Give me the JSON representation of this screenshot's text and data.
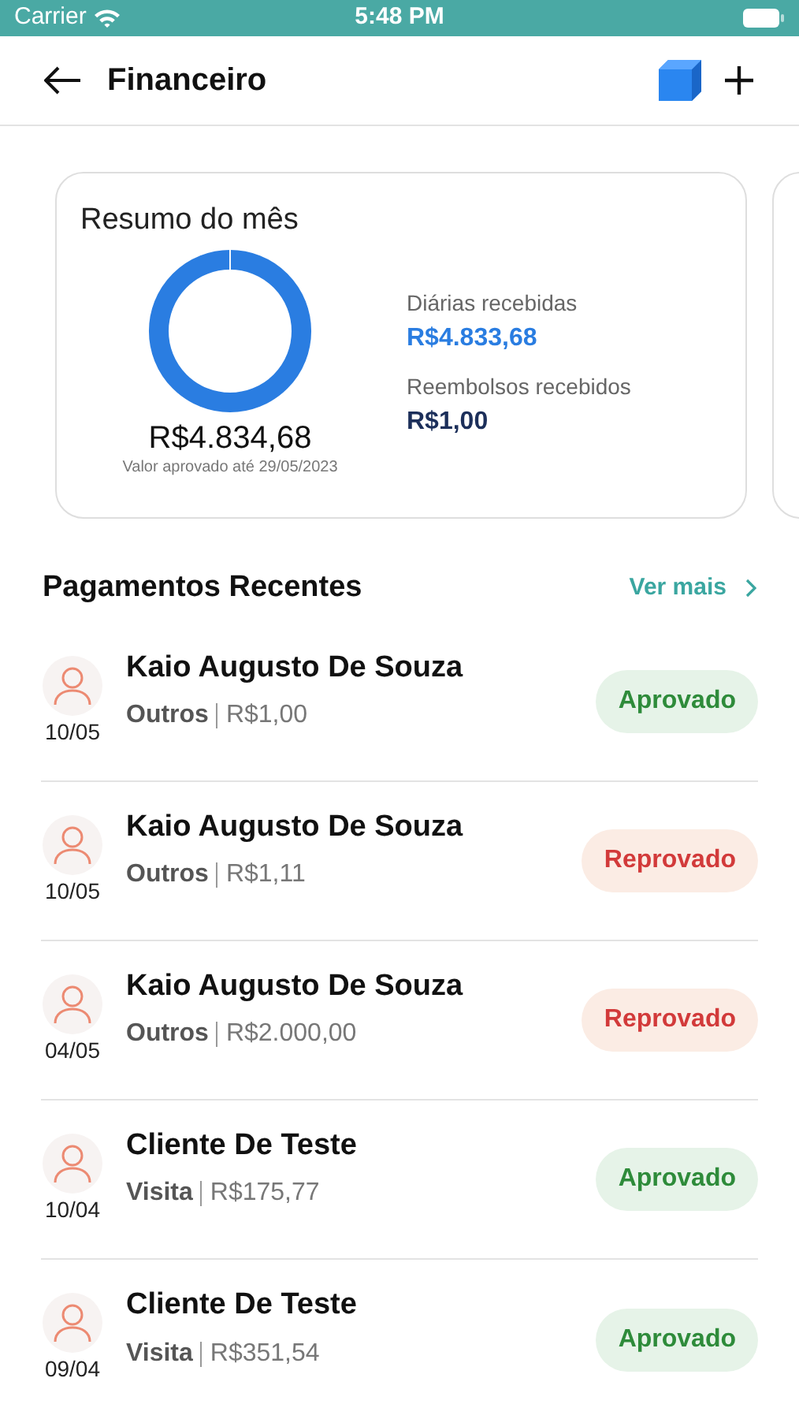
{
  "status_bar": {
    "carrier": "Carrier",
    "time": "5:48 PM"
  },
  "header": {
    "title": "Financeiro"
  },
  "summary": {
    "title": "Resumo do mês",
    "total": "R$4.834,68",
    "note": "Valor aprovado até 29/05/2023",
    "items": [
      {
        "label": "Diárias recebidas",
        "value": "R$4.833,68",
        "color": "#2a7de1"
      },
      {
        "label": "Reembolsos recebidos",
        "value": "R$1,00",
        "color": "#1c2f5a"
      }
    ]
  },
  "payments": {
    "title": "Pagamentos Recentes",
    "more": "Ver mais",
    "rows": [
      {
        "name": "Kaio Augusto De Souza",
        "category": "Outros",
        "amount": "R$1,00",
        "date": "10/05",
        "status": {
          "label": "Aprovado",
          "kind": "approved"
        }
      },
      {
        "name": "Kaio Augusto De Souza",
        "category": "Outros",
        "amount": "R$1,11",
        "date": "10/05",
        "status": {
          "label": "Reprovado",
          "kind": "rejected"
        }
      },
      {
        "name": "Kaio Augusto De Souza",
        "category": "Outros",
        "amount": "R$2.000,00",
        "date": "04/05",
        "status": {
          "label": "Reprovado",
          "kind": "rejected"
        }
      },
      {
        "name": "Cliente De Teste",
        "category": "Visita",
        "amount": "R$175,77",
        "date": "10/04",
        "status": {
          "label": "Aprovado",
          "kind": "approved"
        }
      },
      {
        "name": "Cliente De Teste",
        "category": "Visita",
        "amount": "R$351,54",
        "date": "09/04",
        "status": {
          "label": "Aprovado",
          "kind": "approved"
        }
      }
    ]
  }
}
